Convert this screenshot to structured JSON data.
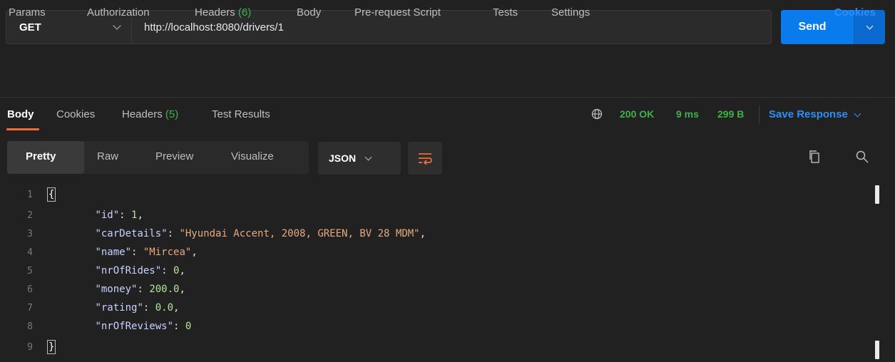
{
  "request": {
    "method": "GET",
    "url": "http://localhost:8080/drivers/1",
    "send_label": "Send"
  },
  "request_tabs": {
    "params": "Params",
    "authorization": "Authorization",
    "headers": "Headers",
    "headers_count": "(6)",
    "body": "Body",
    "prerequest": "Pre-request Script",
    "tests": "Tests",
    "settings": "Settings",
    "cookies": "Cookies"
  },
  "response_tabs": {
    "body": "Body",
    "cookies": "Cookies",
    "headers": "Headers",
    "headers_count": "(5)",
    "test_results": "Test Results"
  },
  "response_status": {
    "status": "200 OK",
    "time": "9 ms",
    "size": "299 B",
    "save_label": "Save Response"
  },
  "view": {
    "pretty": "Pretty",
    "raw": "Raw",
    "preview": "Preview",
    "visualize": "Visualize",
    "format": "JSON"
  },
  "code": {
    "line_numbers": [
      "1",
      "2",
      "3",
      "4",
      "5",
      "6",
      "7",
      "8",
      "9"
    ],
    "open_brace": "{",
    "close_brace": "}",
    "fields": [
      {
        "key": "\"id\"",
        "value": "1",
        "kind": "num",
        "comma": ","
      },
      {
        "key": "\"carDetails\"",
        "value": "\"Hyundai Accent, 2008, GREEN, BV 28 MDM\"",
        "kind": "str",
        "comma": ","
      },
      {
        "key": "\"name\"",
        "value": "\"Mircea\"",
        "kind": "str",
        "comma": ","
      },
      {
        "key": "\"nrOfRides\"",
        "value": "0",
        "kind": "num",
        "comma": ","
      },
      {
        "key": "\"money\"",
        "value": "200.0",
        "kind": "num",
        "comma": ","
      },
      {
        "key": "\"rating\"",
        "value": "0.0",
        "kind": "num",
        "comma": ","
      },
      {
        "key": "\"nrOfReviews\"",
        "value": "0",
        "kind": "num",
        "comma": ""
      }
    ]
  },
  "colors": {
    "accent_blue": "#097bed",
    "status_green": "#3fb04a",
    "active_underline": "#f26b3a"
  }
}
